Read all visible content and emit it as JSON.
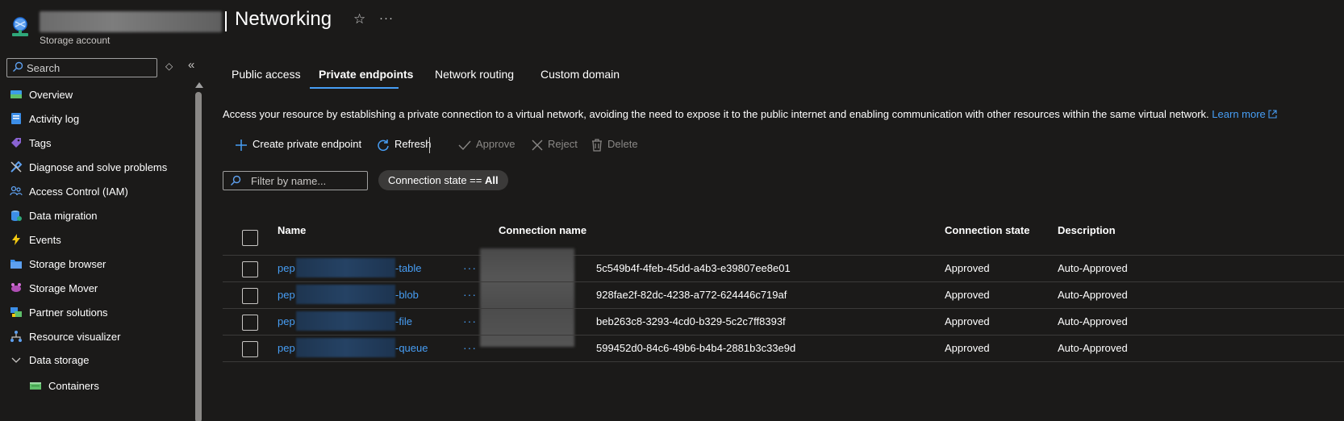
{
  "header": {
    "title": "Networking",
    "subtitle": "Storage account"
  },
  "sidebar": {
    "search_placeholder": "Search",
    "items": [
      {
        "label": "Overview",
        "icon": "overview-icon"
      },
      {
        "label": "Activity log",
        "icon": "activity-log-icon"
      },
      {
        "label": "Tags",
        "icon": "tag-icon"
      },
      {
        "label": "Diagnose and solve problems",
        "icon": "wrench-icon"
      },
      {
        "label": "Access Control (IAM)",
        "icon": "people-icon"
      },
      {
        "label": "Data migration",
        "icon": "data-migration-icon"
      },
      {
        "label": "Events",
        "icon": "lightning-icon"
      },
      {
        "label": "Storage browser",
        "icon": "folder-icon"
      },
      {
        "label": "Storage Mover",
        "icon": "storage-mover-icon"
      },
      {
        "label": "Partner solutions",
        "icon": "partner-icon"
      },
      {
        "label": "Resource visualizer",
        "icon": "hierarchy-icon"
      },
      {
        "label": "Data storage",
        "icon": "chevron-down-icon"
      },
      {
        "label": "Containers",
        "icon": "container-icon"
      }
    ]
  },
  "tabs": [
    {
      "label": "Public access",
      "active": false
    },
    {
      "label": "Private endpoints",
      "active": true
    },
    {
      "label": "Network routing",
      "active": false
    },
    {
      "label": "Custom domain",
      "active": false
    }
  ],
  "description": {
    "text": "Access your resource by establishing a private connection to a virtual network, avoiding the need to expose it to the public internet and enabling communication with other resources within the same virtual network.",
    "learn_more": "Learn more"
  },
  "toolbar": {
    "create": "Create private endpoint",
    "refresh": "Refresh",
    "approve": "Approve",
    "reject": "Reject",
    "delete": "Delete"
  },
  "filter": {
    "placeholder": "Filter by name...",
    "pill_prefix": "Connection state == ",
    "pill_value": "All"
  },
  "table": {
    "headers": {
      "name": "Name",
      "connection_name": "Connection name",
      "connection_state": "Connection state",
      "description": "Description"
    },
    "rows": [
      {
        "name_prefix": "pep",
        "name_suffix": "-table",
        "connection_name_suffix": "5c549b4f-4feb-45dd-a4b3-e39807ee8e01",
        "state": "Approved",
        "description": "Auto-Approved"
      },
      {
        "name_prefix": "pep",
        "name_suffix": "-blob",
        "connection_name_suffix": "928fae2f-82dc-4238-a772-624446c719af",
        "state": "Approved",
        "description": "Auto-Approved"
      },
      {
        "name_prefix": "pep",
        "name_suffix": "-file",
        "connection_name_suffix": "beb263c8-3293-4cd0-b329-5c2c7ff8393f",
        "state": "Approved",
        "description": "Auto-Approved"
      },
      {
        "name_prefix": "pep",
        "name_suffix": "-queue",
        "connection_name_suffix": "599452d0-84c6-49b6-b4b4-2881b3c33e9d",
        "state": "Approved",
        "description": "Auto-Approved"
      }
    ]
  },
  "colors": {
    "background": "#1b1a19",
    "link": "#479ef5",
    "disabled": "#8a8886"
  }
}
